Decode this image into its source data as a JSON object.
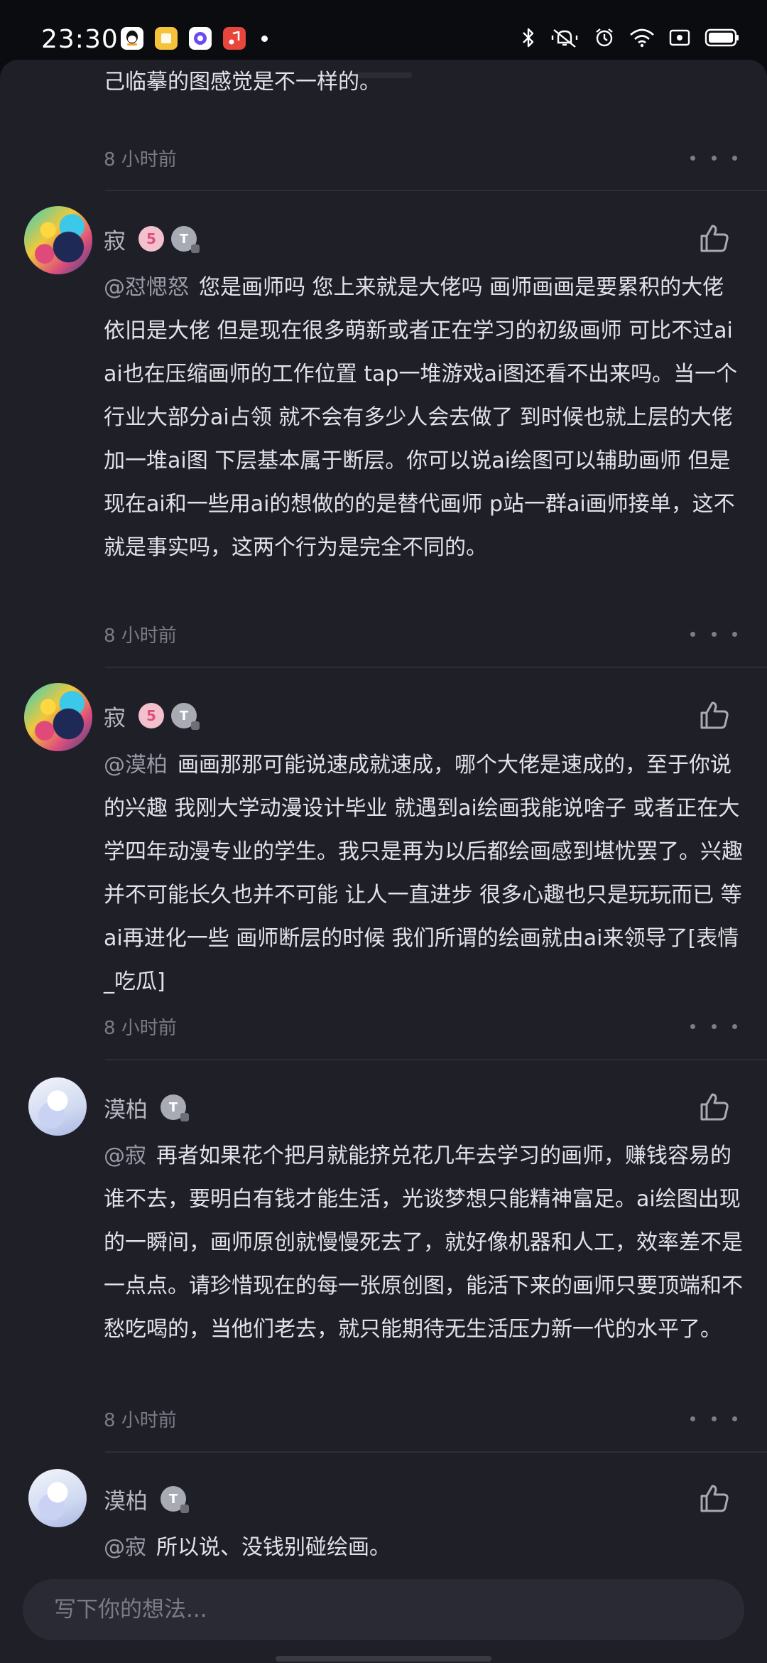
{
  "status_bar": {
    "time": "23:30",
    "apps": [
      "qq-icon",
      "notes-app-icon",
      "browser-app-icon",
      "music-app-icon"
    ],
    "indicators": [
      "bluetooth-icon",
      "mute-vibrate-icon",
      "alarm-icon",
      "wifi-icon",
      "screen-record-icon",
      "battery-icon"
    ]
  },
  "comments": [
    {
      "text": "己临摹的图感觉是不一样的。",
      "time": "8 小时前"
    },
    {
      "user": "寂",
      "badge_level": "5",
      "badge_type": "T",
      "mention": "@怼愢怒",
      "text": "您是画师吗  您上来就是大佬吗 画师画画是要累积的大佬依旧是大佬 但是现在很多萌新或者正在学习的初级画师 可比不过ai ai也在压缩画师的工作位置 tap一堆游戏ai图还看不出来吗。当一个行业大部分ai占领 就不会有多少人会去做了 到时候也就上层的大佬加一堆ai图 下层基本属于断层。你可以说ai绘图可以辅助画师 但是现在ai和一些用ai的想做的的是替代画师  p站一群ai画师接单，这不就是事实吗，这两个行为是完全不同的。",
      "time": "8 小时前"
    },
    {
      "user": "寂",
      "badge_level": "5",
      "badge_type": "T",
      "mention": "@漠柏",
      "text": "画画那那可能说速成就速成，哪个大佬是速成的，至于你说的兴趣 我刚大学动漫设计毕业 就遇到ai绘画我能说啥子 或者正在大学四年动漫专业的学生。我只是再为以后都绘画感到堪忧罢了。兴趣并不可能长久也并不可能 让人一直进步 很多心趣也只是玩玩而已  等ai再进化一些  画师断层的时候 我们所谓的绘画就由ai来领导了[表情_吃瓜]",
      "time": "8 小时前"
    },
    {
      "user": "漠柏",
      "badge_type": "T",
      "mention": "@寂",
      "text": "再者如果花个把月就能挤兑花几年去学习的画师，赚钱容易的谁不去，要明白有钱才能生活，光谈梦想只能精神富足。ai绘图出现的一瞬间，画师原创就慢慢死去了，就好像机器和人工，效率差不是一点点。请珍惜现在的每一张原创图，能活下来的画师只要顶端和不愁吃喝的，当他们老去，就只能期待无生活压力新一代的水平了。",
      "time": "8 小时前"
    },
    {
      "user": "漠柏",
      "badge_type": "T",
      "mention": "@寂",
      "text": "所以说、没钱别碰绘画。"
    }
  ],
  "composer": {
    "placeholder": "写下你的想法..."
  }
}
